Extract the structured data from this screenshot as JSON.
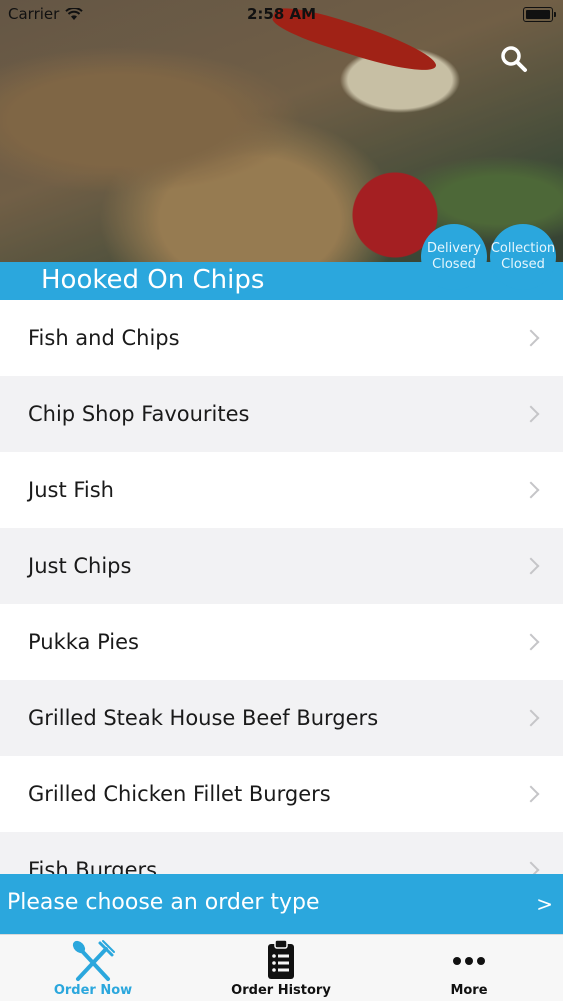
{
  "status_bar": {
    "carrier": "Carrier",
    "time": "2:58 AM"
  },
  "header": {
    "title": "Hooked On Chips",
    "delivery": {
      "line1": "Delivery",
      "line2": "Closed"
    },
    "collection": {
      "line1": "Collection",
      "line2": "Closed"
    }
  },
  "menu": {
    "items": [
      {
        "label": "Fish and Chips"
      },
      {
        "label": "Chip Shop Favourites"
      },
      {
        "label": "Just Fish"
      },
      {
        "label": "Just Chips"
      },
      {
        "label": "Pukka Pies"
      },
      {
        "label": "Grilled Steak House Beef Burgers"
      },
      {
        "label": "Grilled Chicken Fillet Burgers"
      },
      {
        "label": "Fish Burgers"
      }
    ]
  },
  "order_banner": {
    "text": "Please choose an order type",
    "arrow": ">"
  },
  "tabbar": {
    "order_now": "Order Now",
    "order_history": "Order History",
    "more": "More"
  },
  "colors": {
    "accent": "#2ba7dd",
    "row_alt": "#f2f2f4"
  }
}
